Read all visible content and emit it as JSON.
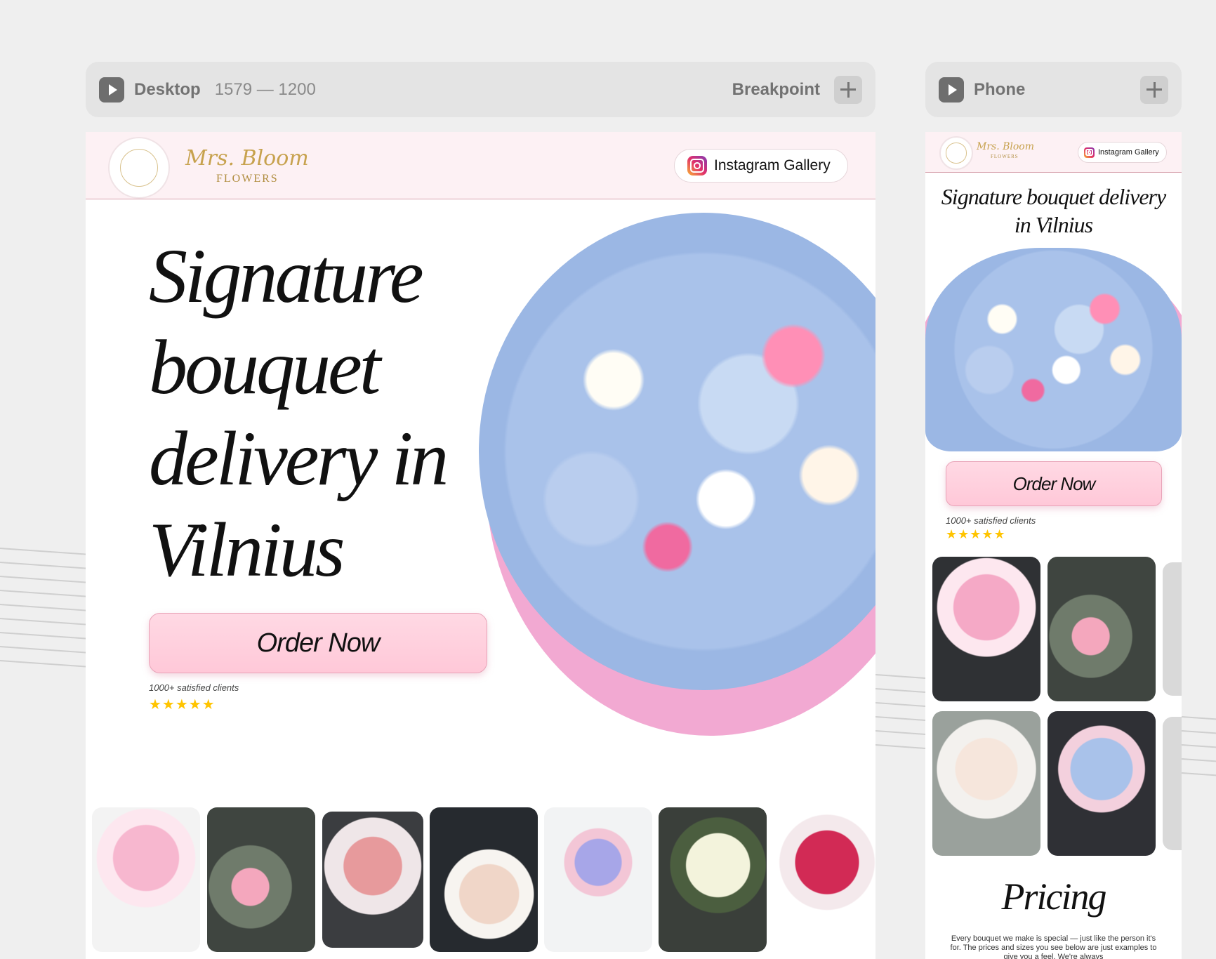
{
  "desktop_bar": {
    "label": "Desktop",
    "size": "1579 — 1200",
    "breakpoint_label": "Breakpoint"
  },
  "phone_bar": {
    "label": "Phone"
  },
  "site": {
    "brand_name": "Mrs. Bloom",
    "brand_sub": "FLOWERS",
    "instagram_label": "Instagram Gallery",
    "hero": {
      "title_desktop_lines": [
        "Signature",
        "bouquet",
        "delivery in",
        "Vilnius"
      ],
      "title_phone_lines": [
        "Signature bouquet delivery",
        "in Vilnius"
      ],
      "order_label": "Order Now",
      "clients_text": "1000+ satisfied clients",
      "stars": "★★★★★",
      "rating_stars": 4.5
    },
    "pricing": {
      "title": "Pricing",
      "text": "Every bouquet we make is special — just like the person it's for. The prices and sizes you see below are just examples to give you a feel. We're always"
    },
    "colors": {
      "accent_pink": "#ffc8d8",
      "header_bg": "#fdf1f4",
      "brand_gold": "#c7a24e",
      "star_yellow": "#ffc400"
    }
  }
}
